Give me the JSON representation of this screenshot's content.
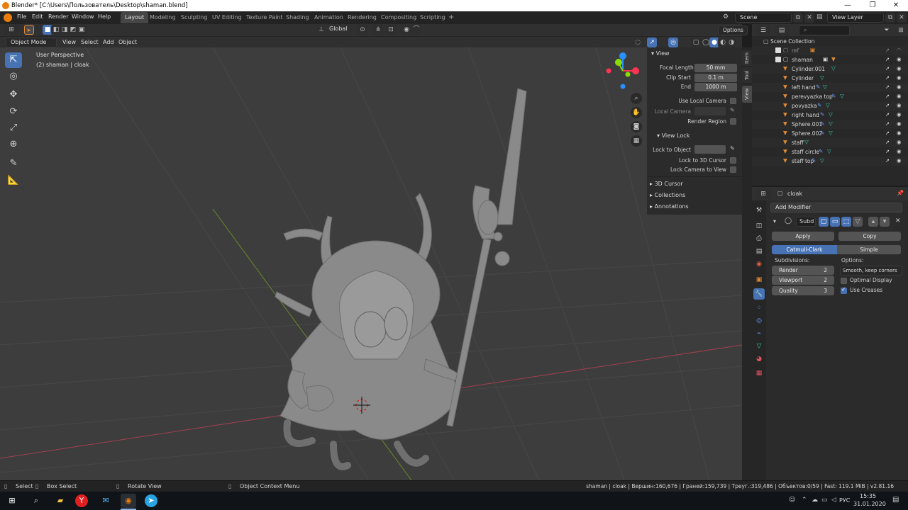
{
  "window": {
    "title": "Blender* [C:\\Users\\Пользователь\\Desktop\\shaman.blend]",
    "controls": [
      "—",
      "❐",
      "✕"
    ]
  },
  "menu": [
    "File",
    "Edit",
    "Render",
    "Window",
    "Help"
  ],
  "workspaces": [
    "Layout",
    "Modeling",
    "Sculpting",
    "UV Editing",
    "Texture Paint",
    "Shading",
    "Animation",
    "Rendering",
    "Compositing",
    "Scripting"
  ],
  "workspace_add": "+",
  "scene": {
    "name": "Scene",
    "view_layer": "View Layer"
  },
  "header": {
    "transform_orientation": "Global",
    "options_label": "Options"
  },
  "viewport_header": {
    "mode": "Object Mode",
    "menus": [
      "View",
      "Select",
      "Add",
      "Object"
    ]
  },
  "viewport": {
    "perspective": "User Perspective",
    "context": "(2) shaman | cloak",
    "gizmo": {
      "z": "Z",
      "y": "Y",
      "x": "X"
    }
  },
  "npanel": {
    "view_header": "View",
    "focal_length_label": "Focal Length",
    "focal_length": "50 mm",
    "clip_start_label": "Clip Start",
    "clip_start": "0.1 m",
    "end_label": "End",
    "end": "1000 m",
    "use_local_camera": "Use Local Camera",
    "local_camera": "Local Camera",
    "render_region": "Render Region",
    "view_lock": "View Lock",
    "lock_to_object": "Lock to Object",
    "lock_to_3d_cursor": "Lock to 3D Cursor",
    "lock_camera_to_view": "Lock Camera to View",
    "sections": [
      "3D Cursor",
      "Collections",
      "Annotations"
    ],
    "tabs": [
      "Item",
      "Tool",
      "View"
    ]
  },
  "outliner": {
    "root": "Scene Collection",
    "items": [
      "ref",
      "shaman",
      "Cylinder.001",
      "Cylinder",
      "left hand",
      "perevyazka top",
      "povyazka",
      "right hand",
      "Sphere.001",
      "Sphere.002",
      "staff",
      "staff circle",
      "staff top"
    ]
  },
  "properties": {
    "object_name": "cloak",
    "add_modifier": "Add Modifier",
    "modifier_name": "Subd",
    "apply": "Apply",
    "copy": "Copy",
    "catmull_clark": "Catmull-Clark",
    "simple": "Simple",
    "subdivisions": "Subdivisions:",
    "options": "Options:",
    "render_label": "Render",
    "render_value": "2",
    "viewport_label": "Viewport",
    "viewport_value": "2",
    "quality_label": "Quality",
    "quality_value": "3",
    "uv_smooth": "Smooth, keep corners",
    "optimal_display": "Optimal Display",
    "use_creases": "Use Creases"
  },
  "statusbar": {
    "select": "Select",
    "box_select": "Box Select",
    "rotate_view": "Rotate View",
    "context_menu": "Object Context Menu",
    "stats": "shaman | cloak | Вершин:160,676 | Граней:159,739 | Треуг.:319,486 | Объектов:0/59 | Fast: 119.1 MiB | v2.81.16"
  },
  "taskbar": {
    "lang": "РУС",
    "time": "15:35",
    "date": "31.01.2020"
  },
  "colors": {
    "accent": "#4772b3",
    "viewport_bg": "#3d3d3d",
    "axis_x": "#ff3352",
    "axis_y": "#8bdc00",
    "axis_z": "#2890ff",
    "object_orange": "#e08a34"
  }
}
